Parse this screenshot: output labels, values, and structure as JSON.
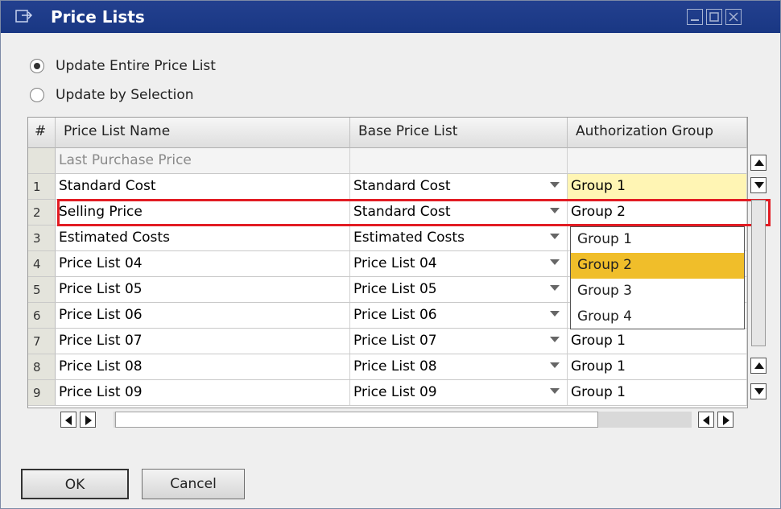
{
  "window": {
    "title": "Price Lists"
  },
  "options": {
    "update_entire": "Update Entire Price List",
    "update_selection": "Update by Selection",
    "selected": "update_entire"
  },
  "grid": {
    "columns": [
      "#",
      "Price List Name",
      "Base Price List",
      "Authorization Group"
    ],
    "header_row": {
      "name": "Last Purchase Price"
    },
    "rows": [
      {
        "num": "1",
        "name": "Standard Cost",
        "base": "Standard Cost",
        "group": "Group 1"
      },
      {
        "num": "2",
        "name": "Selling Price",
        "base": "Standard Cost",
        "group": "Group 2"
      },
      {
        "num": "3",
        "name": "Estimated Costs",
        "base": "Estimated Costs",
        "group": ""
      },
      {
        "num": "4",
        "name": "Price List 04",
        "base": "Price List 04",
        "group": ""
      },
      {
        "num": "5",
        "name": "Price List 05",
        "base": "Price List 05",
        "group": ""
      },
      {
        "num": "6",
        "name": "Price List 06",
        "base": "Price List 06",
        "group": ""
      },
      {
        "num": "7",
        "name": "Price List 07",
        "base": "Price List 07",
        "group": "Group 1"
      },
      {
        "num": "8",
        "name": "Price List 08",
        "base": "Price List 08",
        "group": "Group 1"
      },
      {
        "num": "9",
        "name": "Price List 09",
        "base": "Price List 09",
        "group": "Group 1"
      }
    ]
  },
  "dropdown": {
    "options": [
      "Group 1",
      "Group 2",
      "Group 3",
      "Group 4"
    ],
    "highlighted": "Group 2"
  },
  "buttons": {
    "ok": "OK",
    "cancel": "Cancel"
  },
  "colors": {
    "titlebar": "#193783",
    "active_cell": "#fff5b4",
    "highlight": "#f0be2a",
    "selection_outline": "#e21c23"
  }
}
